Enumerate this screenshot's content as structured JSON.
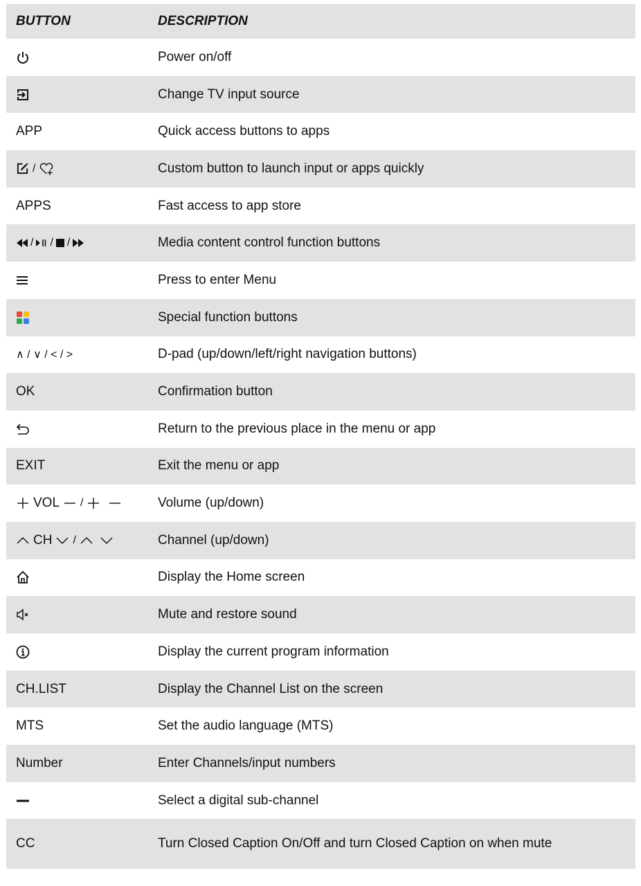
{
  "header": {
    "button": "BUTTON",
    "description": "DESCRIPTION"
  },
  "rows": [
    {
      "button_icon": "power-icon",
      "description": "Power on/off"
    },
    {
      "button_icon": "input-source-icon",
      "description": "Change TV input source"
    },
    {
      "button_text": "APP",
      "description": "Quick access buttons to apps"
    },
    {
      "button_icons": [
        "edit-icon",
        "heart-plus-icon"
      ],
      "separator": "/",
      "description": "Custom button to launch input or apps quickly"
    },
    {
      "button_text": "APPS",
      "description": "Fast access to app store"
    },
    {
      "button_icons": [
        "rewind-icon",
        "play-pause-icon",
        "stop-icon",
        "fast-forward-icon"
      ],
      "separator": "/",
      "description": "Media content control function buttons"
    },
    {
      "button_icon": "menu-icon",
      "description": "Press to enter Menu"
    },
    {
      "button_icon": "color-buttons-icon",
      "colors": [
        "#e84a3c",
        "#f4c20d",
        "#2fa84f",
        "#3b7ddd"
      ],
      "description": "Special function buttons"
    },
    {
      "button_text": "∧ / ∨ / < / >",
      "description": "D-pad (up/down/left/right navigation buttons)"
    },
    {
      "button_text": "OK",
      "description": "Confirmation button"
    },
    {
      "button_icon": "back-icon",
      "description": "Return to the previous place in the menu or app"
    },
    {
      "button_text": "EXIT",
      "description": "Exit the menu or app"
    },
    {
      "button_label": "VOL",
      "button_icons": [
        "plus-icon",
        "minus-icon"
      ],
      "separator": "/",
      "description": "Volume (up/down)"
    },
    {
      "button_label": "CH",
      "button_icons": [
        "chevron-up-icon",
        "chevron-down-icon"
      ],
      "separator": "/",
      "description": "Channel (up/down)"
    },
    {
      "button_icon": "home-icon",
      "description": "Display the Home screen"
    },
    {
      "button_icon": "mute-icon",
      "description": "Mute and restore sound"
    },
    {
      "button_icon": "info-icon",
      "description": "Display the current program information"
    },
    {
      "button_text": "CH.LIST",
      "description": "Display the Channel List on the screen"
    },
    {
      "button_text": "MTS",
      "description": "Set the audio language (MTS)"
    },
    {
      "button_text": "Number",
      "description": "Enter Channels/input numbers"
    },
    {
      "button_icon": "dash-icon",
      "description": "Select a digital sub-channel"
    },
    {
      "button_text": "CC",
      "description": "Turn Closed Caption On/Off and turn Closed Caption on when mute"
    }
  ]
}
